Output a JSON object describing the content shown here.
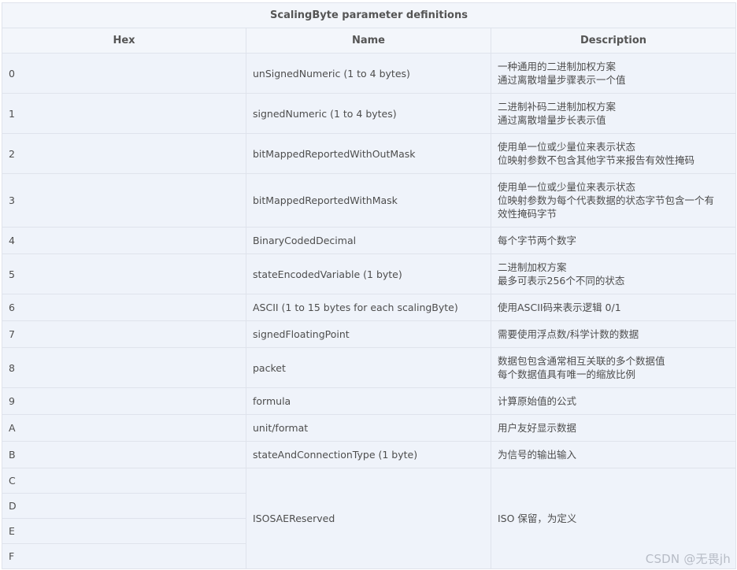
{
  "table": {
    "caption": "ScalingByte parameter definitions",
    "headers": {
      "hex": "Hex",
      "name": "Name",
      "description": "Description"
    },
    "rows": [
      {
        "hex": "0",
        "name": "unSignedNumeric (1 to 4 bytes)",
        "desc": [
          "一种通用的二进制加权方案",
          "通过离散增量步骤表示一个值"
        ]
      },
      {
        "hex": "1",
        "name": "signedNumeric (1 to 4 bytes)",
        "desc": [
          "二进制补码二进制加权方案",
          "通过离散增量步长表示值"
        ]
      },
      {
        "hex": "2",
        "name": "bitMappedReportedWithOutMask",
        "desc": [
          "使用单一位或少量位来表示状态",
          "位映射参数不包含其他字节来报告有效性掩码"
        ]
      },
      {
        "hex": "3",
        "name": "bitMappedReportedWithMask",
        "desc": [
          "使用单一位或少量位来表示状态",
          "位映射参数为每个代表数据的状态字节包含一个有",
          "效性掩码字节"
        ]
      },
      {
        "hex": "4",
        "name": "BinaryCodedDecimal",
        "desc": [
          "每个字节两个数字"
        ]
      },
      {
        "hex": "5",
        "name": "stateEncodedVariable (1 byte)",
        "desc": [
          "二进制加权方案",
          "最多可表示256个不同的状态"
        ]
      },
      {
        "hex": "6",
        "name": "ASCII (1 to 15 bytes for each scalingByte)",
        "desc": [
          "使用ASCII码来表示逻辑 0/1"
        ]
      },
      {
        "hex": "7",
        "name": "signedFloatingPoint",
        "desc": [
          "需要使用浮点数/科学计数的数据"
        ]
      },
      {
        "hex": "8",
        "name": "packet",
        "desc": [
          "数据包包含通常相互关联的多个数据值",
          "每个数据值具有唯一的缩放比例"
        ]
      },
      {
        "hex": "9",
        "name": "formula",
        "desc": [
          "计算原始值的公式"
        ]
      },
      {
        "hex": "A",
        "name": "unit/format",
        "desc": [
          "用户友好显示数据"
        ]
      },
      {
        "hex": "B",
        "name": "stateAndConnectionType (1 byte)",
        "desc": [
          "为信号的输出输入"
        ]
      }
    ],
    "reserved": {
      "hexes": [
        "C",
        "D",
        "E",
        "F"
      ],
      "name": "ISOSAEReserved",
      "desc": "ISO 保留，为定义"
    }
  },
  "watermark": "CSDN @无畏jh"
}
